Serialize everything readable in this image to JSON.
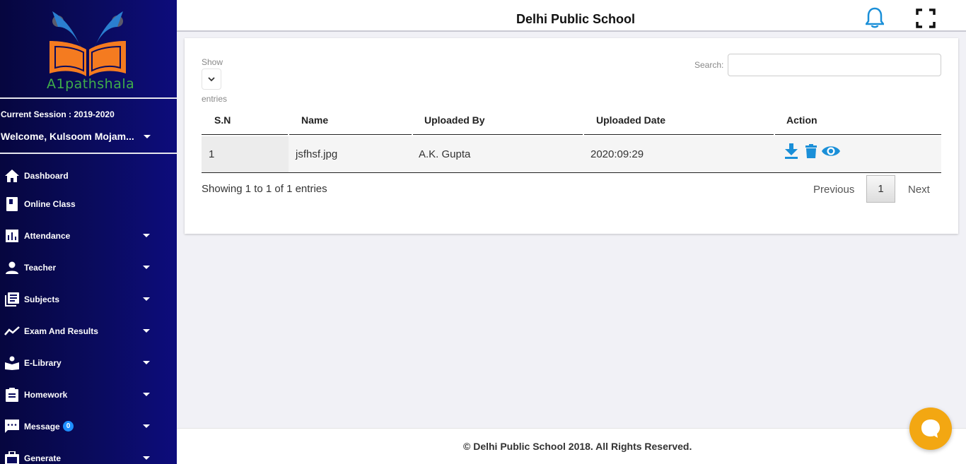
{
  "brand": {
    "logo_text": "A1pathshala",
    "accent": "#3fae49",
    "book_color": "#f47b20"
  },
  "sidebar": {
    "session": "Current Session : 2019-2020",
    "welcome": "Welcome, Kulsoom Mojam...",
    "items": [
      {
        "label": "Dashboard",
        "icon": "home-icon",
        "caret": false
      },
      {
        "label": "Online Class",
        "icon": "book-icon",
        "caret": false
      },
      {
        "label": "Attendance",
        "icon": "bar-chart-icon",
        "caret": true
      },
      {
        "label": "Teacher",
        "icon": "person-icon",
        "caret": true
      },
      {
        "label": "Subjects",
        "icon": "library-icon",
        "caret": true
      },
      {
        "label": "Exam And Results",
        "icon": "trend-line-icon",
        "caret": true
      },
      {
        "label": "E-Library",
        "icon": "reader-icon",
        "caret": true
      },
      {
        "label": "Homework",
        "icon": "clipboard-icon",
        "caret": true
      },
      {
        "label": "Message",
        "icon": "message-icon",
        "caret": true,
        "badge": "0"
      },
      {
        "label": "Generate",
        "icon": "briefcase-icon",
        "caret": true
      }
    ]
  },
  "header": {
    "title": "Delhi Public School",
    "bell_color": "#1a8fd8"
  },
  "table_controls": {
    "show_label": "Show",
    "entries_label": "entries",
    "search_label": "Search:",
    "search_value": ""
  },
  "table": {
    "columns": [
      "S.N",
      "Name",
      "Uploaded By",
      "Uploaded Date",
      "Action"
    ],
    "rows": [
      {
        "sn": "1",
        "name": "jsfhsf.jpg",
        "uploaded_by": "A.K. Gupta",
        "uploaded_date": "2020:09:29"
      }
    ],
    "action_color": "#1a8fd8"
  },
  "pagination": {
    "info": "Showing 1 to 1 of 1 entries",
    "previous": "Previous",
    "current": "1",
    "next": "Next"
  },
  "footer": {
    "copyright": "© Delhi Public School 2018. All Rights Reserved."
  },
  "chat": {
    "color": "#f3a712"
  }
}
